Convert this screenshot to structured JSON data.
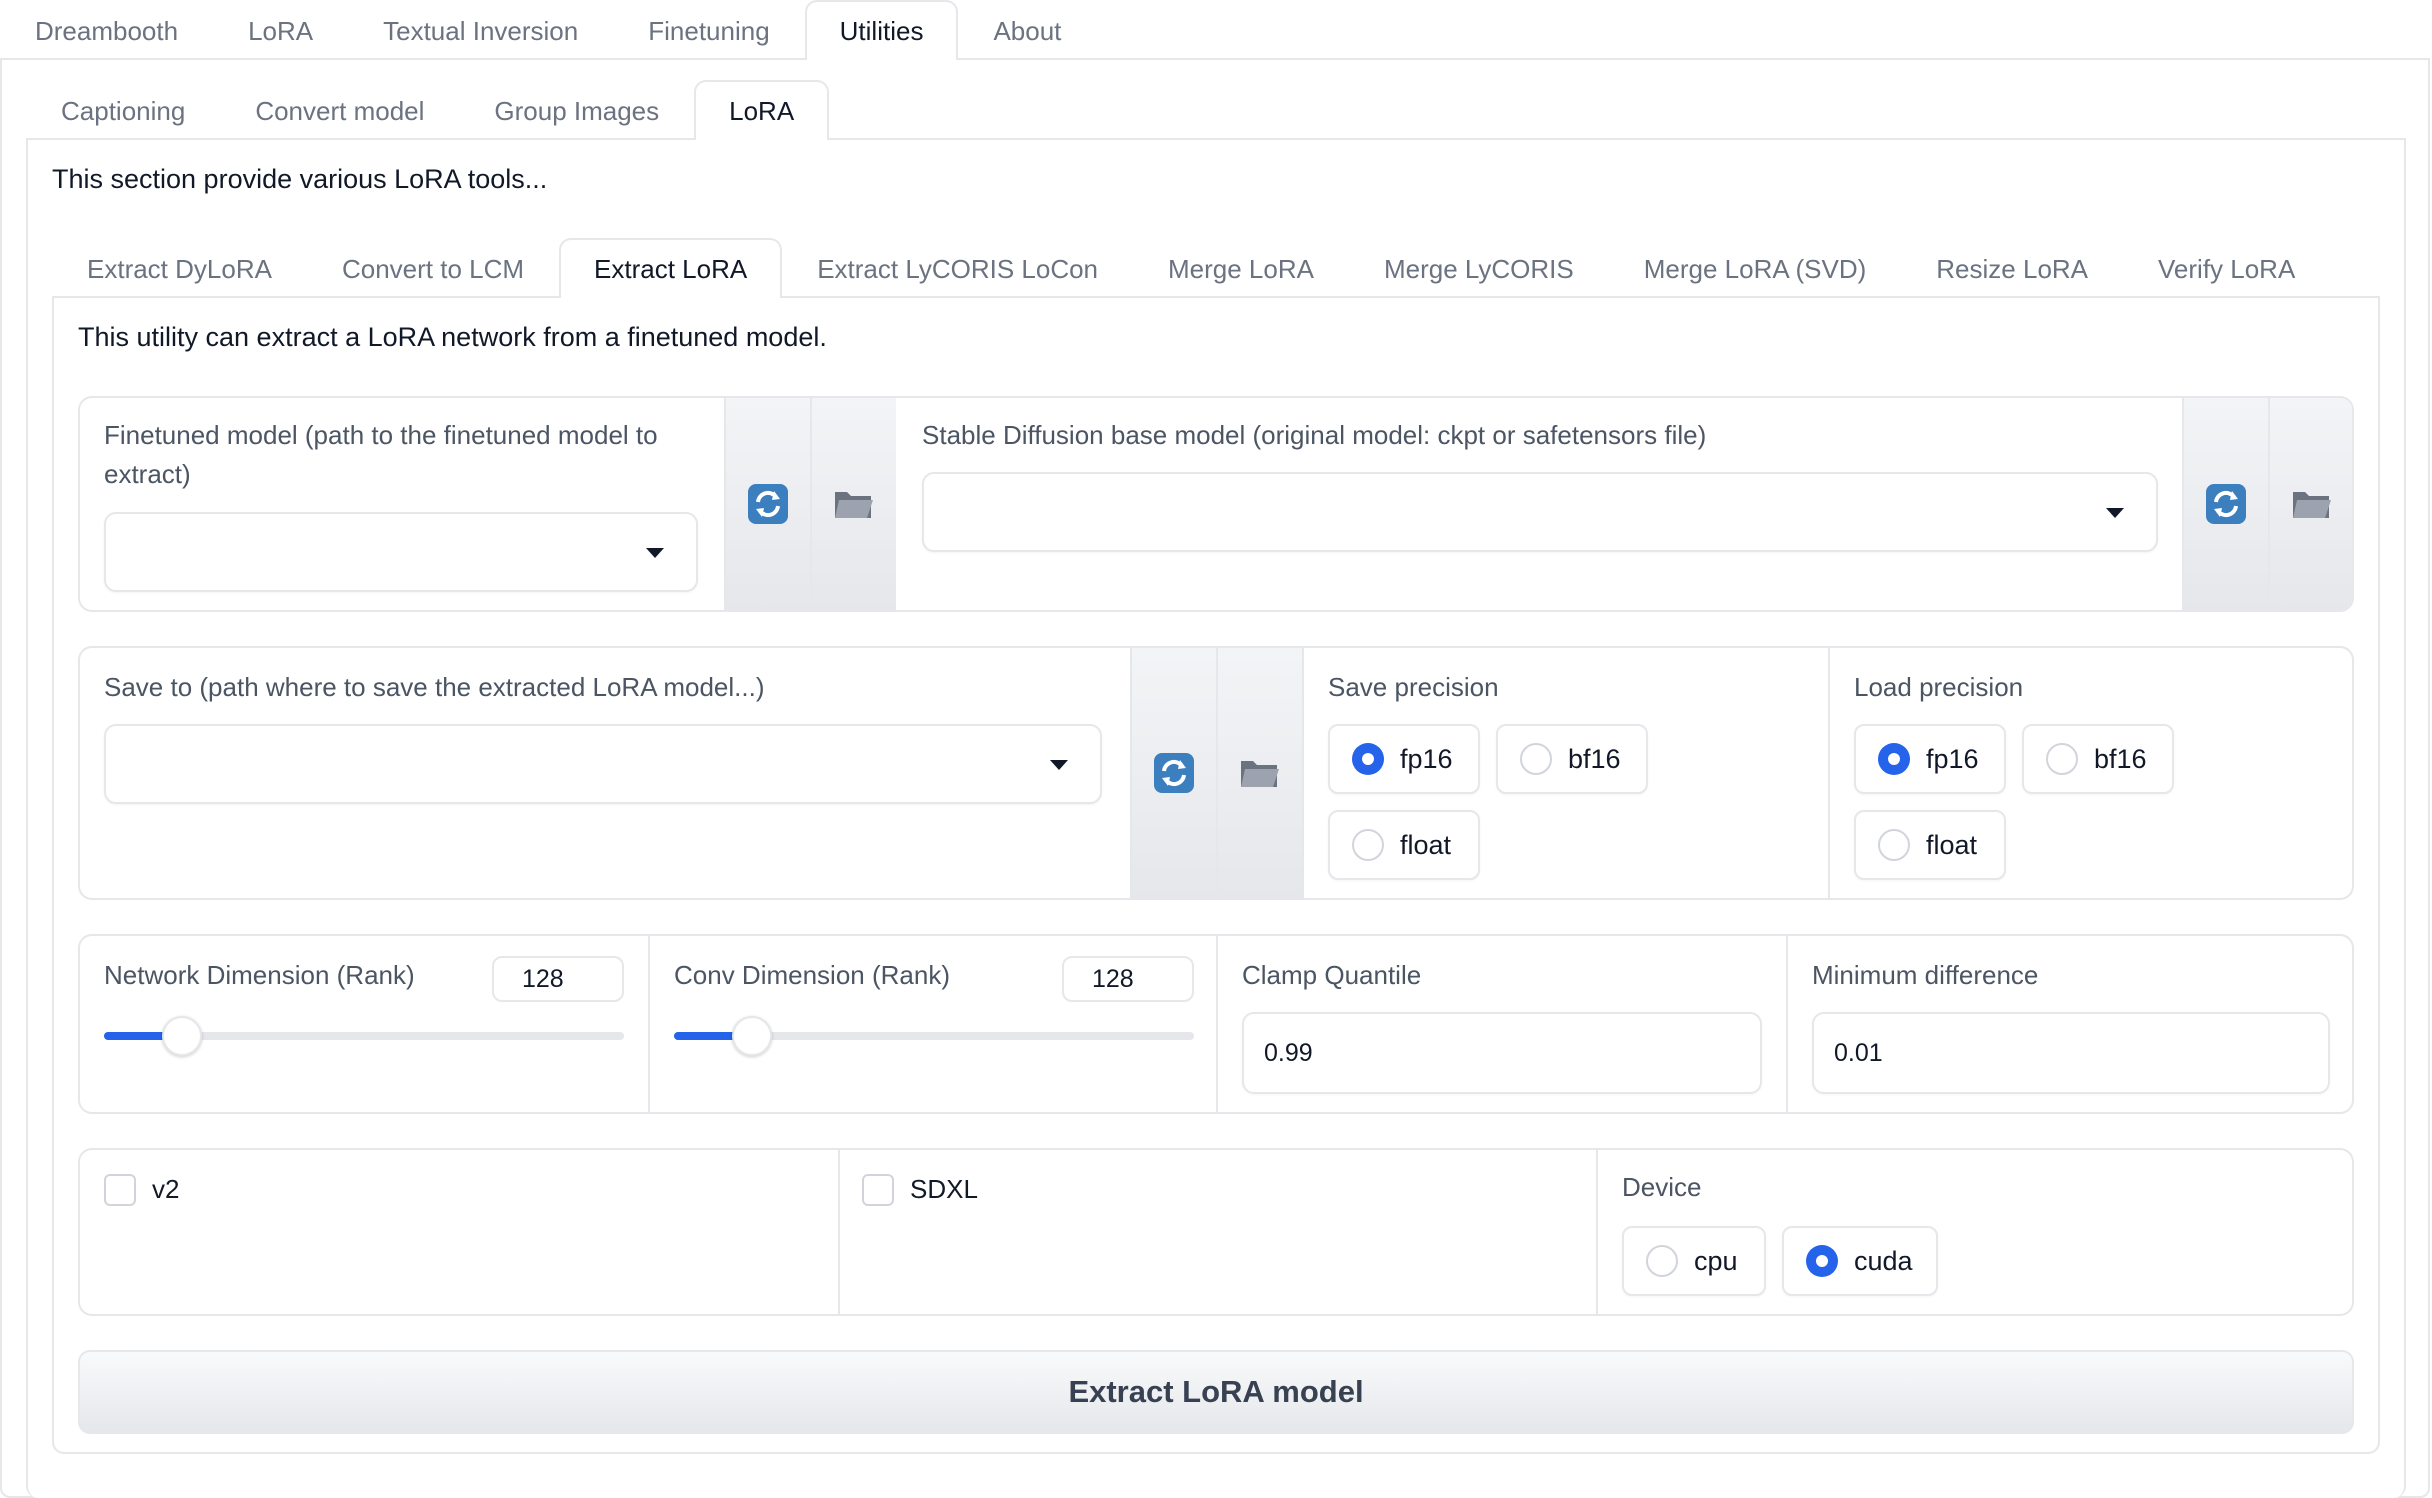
{
  "top_tabs": [
    {
      "label": "Dreambooth",
      "active": false
    },
    {
      "label": "LoRA",
      "active": false
    },
    {
      "label": "Textual Inversion",
      "active": false
    },
    {
      "label": "Finetuning",
      "active": false
    },
    {
      "label": "Utilities",
      "active": true
    },
    {
      "label": "About",
      "active": false
    }
  ],
  "utility_tabs": [
    {
      "label": "Captioning",
      "active": false
    },
    {
      "label": "Convert model",
      "active": false
    },
    {
      "label": "Group Images",
      "active": false
    },
    {
      "label": "LoRA",
      "active": true
    }
  ],
  "section_description": "This section provide various LoRA tools...",
  "lora_tabs": [
    {
      "label": "Extract DyLoRA",
      "active": false
    },
    {
      "label": "Convert to LCM",
      "active": false
    },
    {
      "label": "Extract LoRA",
      "active": true
    },
    {
      "label": "Extract LyCORIS LoCon",
      "active": false
    },
    {
      "label": "Merge LoRA",
      "active": false
    },
    {
      "label": "Merge LyCORIS",
      "active": false
    },
    {
      "label": "Merge LoRA (SVD)",
      "active": false
    },
    {
      "label": "Resize LoRA",
      "active": false
    },
    {
      "label": "Verify LoRA",
      "active": false
    }
  ],
  "utility_description": "This utility can extract a LoRA network from a finetuned model.",
  "finetuned_model": {
    "label": "Finetuned model (path to the finetuned model to extract)",
    "value": ""
  },
  "base_model": {
    "label": "Stable Diffusion base model (original model: ckpt or safetensors file)",
    "value": ""
  },
  "save_to": {
    "label": "Save to (path where to save the extracted LoRA model...)",
    "value": ""
  },
  "save_precision": {
    "label": "Save precision",
    "options": [
      "fp16",
      "bf16",
      "float"
    ],
    "selected": "fp16"
  },
  "load_precision": {
    "label": "Load precision",
    "options": [
      "fp16",
      "bf16",
      "float"
    ],
    "selected": "fp16"
  },
  "network_dimension": {
    "label": "Network Dimension (Rank)",
    "value": "128",
    "fraction": 0.15
  },
  "conv_dimension": {
    "label": "Conv Dimension (Rank)",
    "value": "128",
    "fraction": 0.15
  },
  "clamp_quantile": {
    "label": "Clamp Quantile",
    "value": "0.99"
  },
  "min_diff": {
    "label": "Minimum difference",
    "value": "0.01"
  },
  "v2": {
    "label": "v2",
    "checked": false
  },
  "sdxl": {
    "label": "SDXL",
    "checked": false
  },
  "device": {
    "label": "Device",
    "options": [
      "cpu",
      "cuda"
    ],
    "selected": "cuda"
  },
  "extract_button": "Extract LoRA model",
  "icons": {
    "refresh": "refresh-icon",
    "folder": "folder-icon",
    "caret": "chevron-down-icon"
  },
  "colors": {
    "accent": "#2563eb",
    "border": "#e5e7eb",
    "button_bg": "#e5e7eb"
  }
}
